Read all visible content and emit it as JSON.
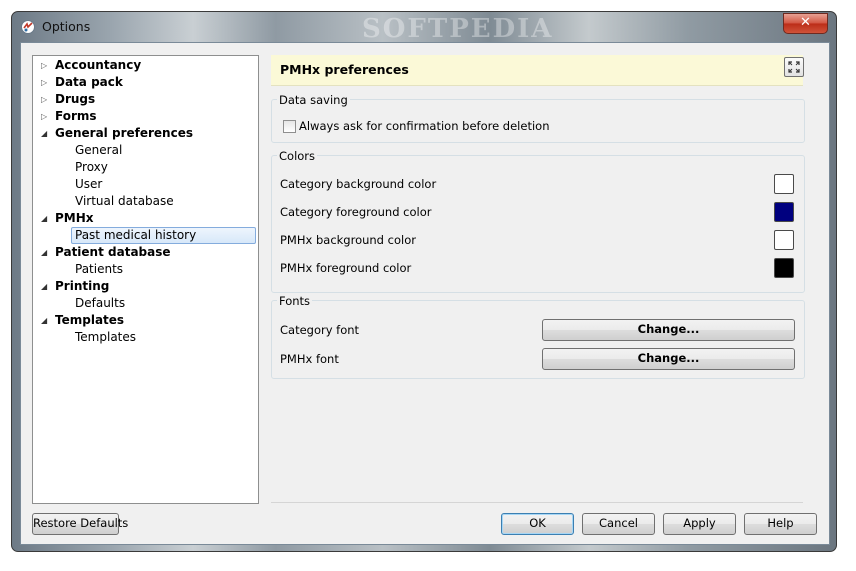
{
  "window": {
    "title": "Options",
    "watermark": "SOFTPEDIA",
    "close_label": "✕"
  },
  "tree": {
    "items": [
      {
        "label": "Accountancy",
        "level": 0,
        "expanded": false
      },
      {
        "label": "Data pack",
        "level": 0,
        "expanded": false
      },
      {
        "label": "Drugs",
        "level": 0,
        "expanded": false
      },
      {
        "label": "Forms",
        "level": 0,
        "expanded": false
      },
      {
        "label": "General preferences",
        "level": 0,
        "expanded": true
      },
      {
        "label": "General",
        "level": 1
      },
      {
        "label": "Proxy",
        "level": 1
      },
      {
        "label": "User",
        "level": 1
      },
      {
        "label": "Virtual database",
        "level": 1
      },
      {
        "label": "PMHx",
        "level": 0,
        "expanded": true
      },
      {
        "label": "Past medical history",
        "level": 1,
        "selected": true
      },
      {
        "label": "Patient database",
        "level": 0,
        "expanded": true
      },
      {
        "label": "Patients",
        "level": 1
      },
      {
        "label": "Printing",
        "level": 0,
        "expanded": true
      },
      {
        "label": "Defaults",
        "level": 1
      },
      {
        "label": "Templates",
        "level": 0,
        "expanded": true
      },
      {
        "label": "Templates",
        "level": 1
      }
    ]
  },
  "panel": {
    "title": "PMHx preferences"
  },
  "data_saving": {
    "title": "Data saving",
    "checkbox_label": "Always ask for confirmation before deletion",
    "checked": false
  },
  "colors": {
    "title": "Colors",
    "rows": [
      {
        "label": "Category background color",
        "color": "#ffffff"
      },
      {
        "label": "Category foreground color",
        "color": "#00007f"
      },
      {
        "label": "PMHx background color",
        "color": "#ffffff"
      },
      {
        "label": "PMHx foreground color",
        "color": "#000000"
      }
    ]
  },
  "fonts": {
    "title": "Fonts",
    "rows": [
      {
        "label": "Category font",
        "button": "Change..."
      },
      {
        "label": "PMHx font",
        "button": "Change..."
      }
    ]
  },
  "buttons": {
    "restore_defaults": "Restore Defaults",
    "ok": "OK",
    "cancel": "Cancel",
    "apply": "Apply",
    "help": "Help"
  }
}
